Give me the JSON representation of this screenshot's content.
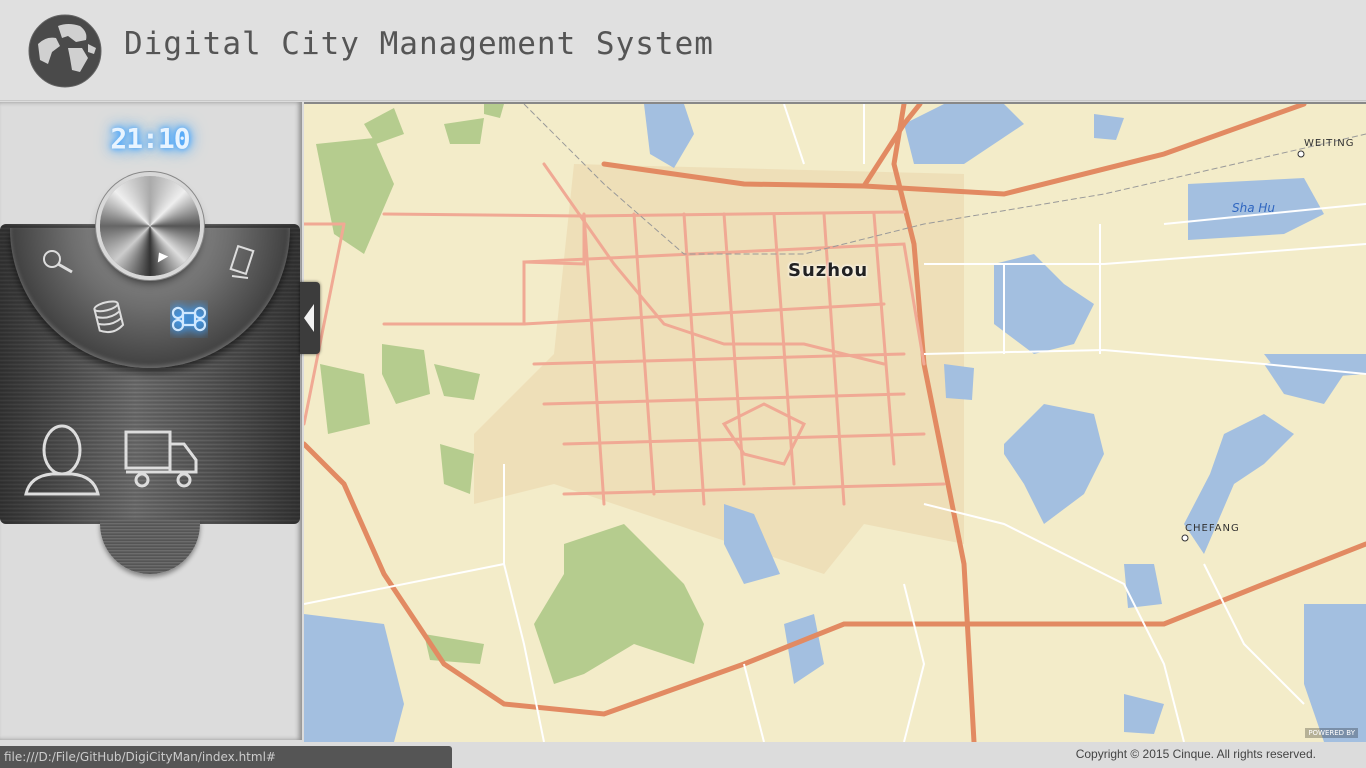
{
  "header": {
    "title": "Digital City Management System",
    "logo_icon": "globe-icon"
  },
  "left_panel": {
    "clock": "21:10",
    "dial": {
      "knob_icon": "play-icon",
      "tools": [
        {
          "name": "search",
          "icon": "magnifier-icon",
          "active": false
        },
        {
          "name": "page",
          "icon": "document-icon",
          "active": false
        },
        {
          "name": "database",
          "icon": "database-icon",
          "active": false
        },
        {
          "name": "command",
          "icon": "command-icon",
          "active": true
        }
      ]
    },
    "modules": [
      {
        "name": "person",
        "icon": "person-icon"
      },
      {
        "name": "truck",
        "icon": "truck-icon"
      }
    ]
  },
  "map": {
    "labels": {
      "city": "Suzhou",
      "town1": "WEITING",
      "lake": "Sha Hu",
      "town2": "CHEFANG"
    },
    "powered_by": "POWERED BY"
  },
  "footer": {
    "status_url": "file:///D:/File/GitHub/DigiCityMan/index.html#",
    "copyright": "Copyright © 2015 Cinque. All rights reserved."
  },
  "colors": {
    "accent_glow": "#3aa0ff",
    "map_land": "#f3ecc9",
    "map_water": "#a3bfe0",
    "map_parks": "#b5cc8e",
    "major_road": "#e28a62",
    "minor_road": "#ffffff"
  }
}
